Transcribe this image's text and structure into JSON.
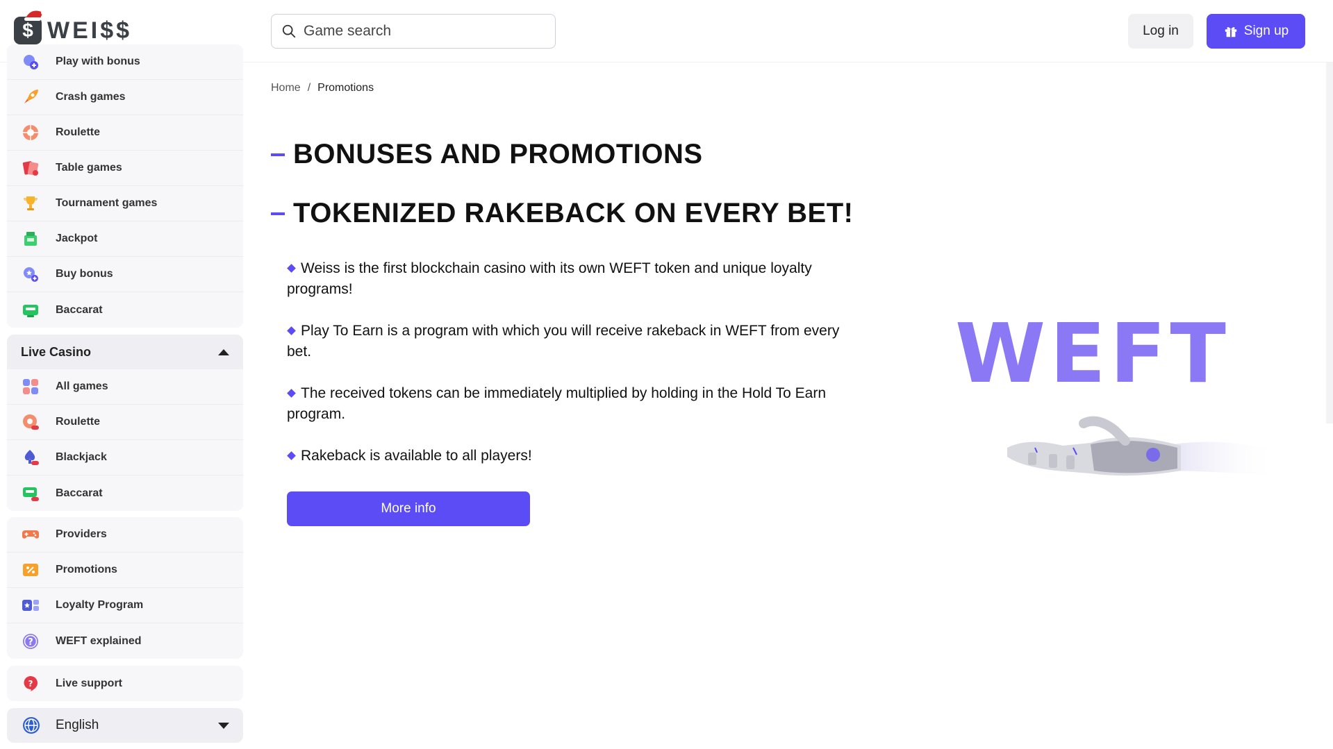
{
  "brand": {
    "name": "WEI$$",
    "badge": "$"
  },
  "search": {
    "placeholder": "Game search"
  },
  "auth": {
    "login": "Log in",
    "signup": "Sign up"
  },
  "sidebar": {
    "games": [
      {
        "label": "Play with bonus",
        "icon": "bonus-icon"
      },
      {
        "label": "Crash games",
        "icon": "rocket-icon"
      },
      {
        "label": "Roulette",
        "icon": "roulette-icon"
      },
      {
        "label": "Table games",
        "icon": "cards-icon"
      },
      {
        "label": "Tournament games",
        "icon": "trophy-icon"
      },
      {
        "label": "Jackpot",
        "icon": "jackpot-icon"
      },
      {
        "label": "Buy bonus",
        "icon": "buy-bonus-icon"
      },
      {
        "label": "Baccarat",
        "icon": "baccarat-icon"
      }
    ],
    "live_casino": {
      "title": "Live Casino",
      "items": [
        {
          "label": "All games",
          "icon": "grid-icon"
        },
        {
          "label": "Roulette",
          "icon": "live-roulette-icon"
        },
        {
          "label": "Blackjack",
          "icon": "blackjack-icon"
        },
        {
          "label": "Baccarat",
          "icon": "live-baccarat-icon"
        }
      ]
    },
    "misc": [
      {
        "label": "Providers",
        "icon": "gamepad-icon"
      },
      {
        "label": "Promotions",
        "icon": "percent-icon"
      },
      {
        "label": "Loyalty Program",
        "icon": "loyalty-icon"
      },
      {
        "label": "WEFT explained",
        "icon": "question-icon"
      }
    ],
    "support": {
      "label": "Live support",
      "icon": "support-icon"
    },
    "language": {
      "label": "English",
      "icon": "globe-icon"
    }
  },
  "breadcrumb": {
    "home": "Home",
    "separator": "/",
    "current": "Promotions"
  },
  "main": {
    "title": "BONUSES AND PROMOTIONS",
    "subtitle": "TOKENIZED RAKEBACK ON EVERY BET!",
    "bullets": [
      "Weiss is the first blockchain casino with its own WEFT token and unique loyalty programs!",
      "Play To Earn is a program with which you will receive rakeback in WEFT from every bet.",
      "The received tokens can be immediately multiplied by holding in the Hold To Earn program.",
      "Rakeback is available to all players!"
    ],
    "cta": "More info",
    "art_word": "WEFT"
  },
  "colors": {
    "accent": "#5b4cf5",
    "weft": "#8a78f5",
    "dark": "#3b3f46"
  }
}
